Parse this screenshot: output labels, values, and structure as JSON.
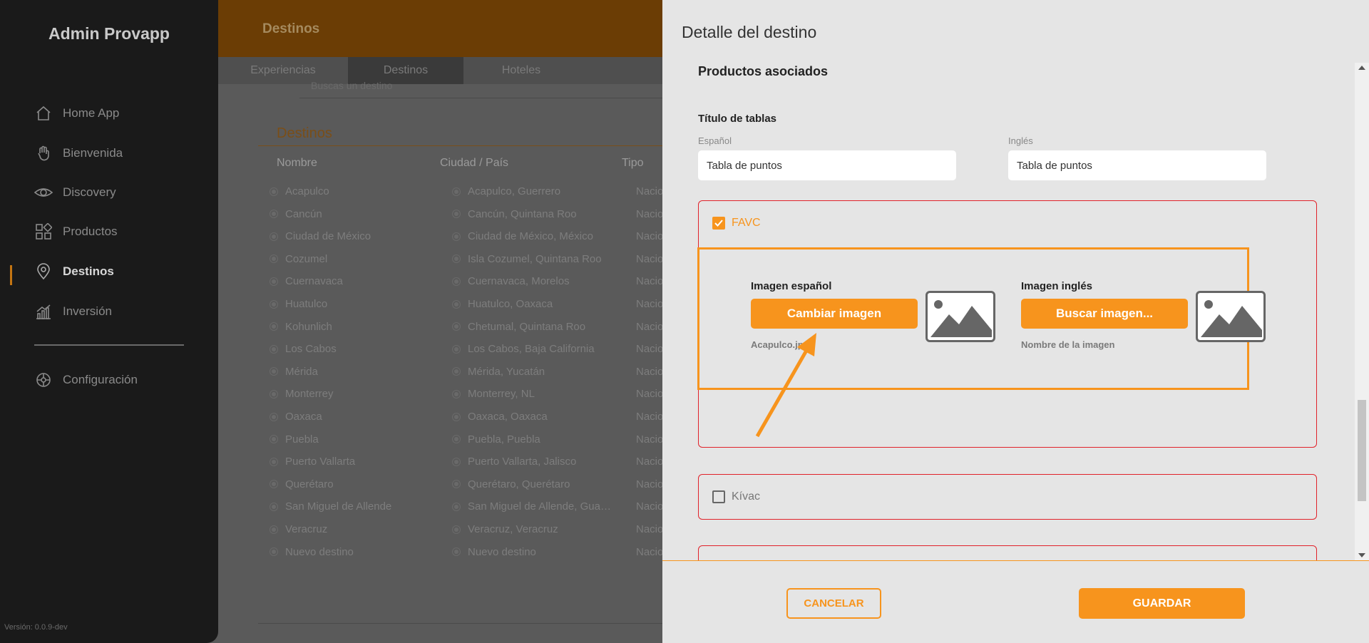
{
  "sidebar": {
    "brand": "Admin Provapp",
    "items": [
      {
        "label": "Home App",
        "icon": "home-icon"
      },
      {
        "label": "Bienvenida",
        "icon": "wave-hand-icon"
      },
      {
        "label": "Discovery",
        "icon": "eye-icon"
      },
      {
        "label": "Productos",
        "icon": "grid-icon"
      },
      {
        "label": "Destinos",
        "icon": "map-pin-icon",
        "active": true
      },
      {
        "label": "Inversión",
        "icon": "chart-icon"
      },
      {
        "label": "Configuración",
        "icon": "settings-icon"
      }
    ],
    "version": "Versión: 0.0.9-dev"
  },
  "background": {
    "topbar_title": "Destinos",
    "tabs": [
      "Experiencias",
      "Destinos",
      "Hoteles"
    ],
    "active_tab": "Destinos",
    "search_placeholder": "Buscas un destino",
    "list_title": "Destinos",
    "columns": [
      "Nombre",
      "Ciudad / País",
      "Tipo"
    ],
    "rows": [
      {
        "name": "Acapulco",
        "city": "Acapulco, Guerrero",
        "type": "Nacio"
      },
      {
        "name": "Cancún",
        "city": "Cancún, Quintana Roo",
        "type": "Nacio"
      },
      {
        "name": "Ciudad de México",
        "city": "Ciudad de México, México",
        "type": "Nacio"
      },
      {
        "name": "Cozumel",
        "city": "Isla Cozumel, Quintana Roo",
        "type": "Nacio"
      },
      {
        "name": "Cuernavaca",
        "city": "Cuernavaca, Morelos",
        "type": "Nacio"
      },
      {
        "name": "Huatulco",
        "city": "Huatulco, Oaxaca",
        "type": "Nacio"
      },
      {
        "name": "Kohunlich",
        "city": "Chetumal, Quintana Roo",
        "type": "Nacio"
      },
      {
        "name": "Los Cabos",
        "city": "Los Cabos, Baja California",
        "type": "Nacio"
      },
      {
        "name": "Mérida",
        "city": "Mérida, Yucatán",
        "type": "Nacio"
      },
      {
        "name": "Monterrey",
        "city": "Monterrey, NL",
        "type": "Nacio"
      },
      {
        "name": "Oaxaca",
        "city": "Oaxaca, Oaxaca",
        "type": "Nacio"
      },
      {
        "name": "Puebla",
        "city": "Puebla, Puebla",
        "type": "Nacio"
      },
      {
        "name": "Puerto Vallarta",
        "city": "Puerto Vallarta, Jalisco",
        "type": "Nacio"
      },
      {
        "name": "Querétaro",
        "city": "Querétaro, Querétaro",
        "type": "Nacio"
      },
      {
        "name": "San Miguel de Allende",
        "city": "San Miguel de Allende, Gua…",
        "type": "Nacio"
      },
      {
        "name": "Veracruz",
        "city": "Veracruz, Veracruz",
        "type": "Nacio"
      },
      {
        "name": "Nuevo destino",
        "city": "Nuevo destino",
        "type": "Nacio"
      }
    ]
  },
  "panel": {
    "header": "Detalle del destino",
    "section_title": "Productos asociados",
    "table_title_label": "Título de tablas",
    "spanish_label": "Español",
    "english_label": "Inglés",
    "spanish_value": "Tabla de puntos",
    "english_value": "Tabla de puntos",
    "favc": {
      "label": "FAVC",
      "checked": true,
      "image_es_label": "Imagen español",
      "image_es_button": "Cambiar imagen",
      "image_es_filename": "Acapulco.jpg",
      "image_en_label": "Imagen inglés",
      "image_en_button": "Buscar imagen...",
      "image_en_filename": "Nombre de la imagen"
    },
    "kivac": {
      "label": "Kívac",
      "checked": false
    },
    "cancel_label": "CANCELAR",
    "save_label": "GUARDAR"
  },
  "colors": {
    "accent": "#f7941d",
    "card_border": "#e1222a",
    "sidebar_bg": "#1a1a1a",
    "panel_bg": "#e5e5e5"
  }
}
